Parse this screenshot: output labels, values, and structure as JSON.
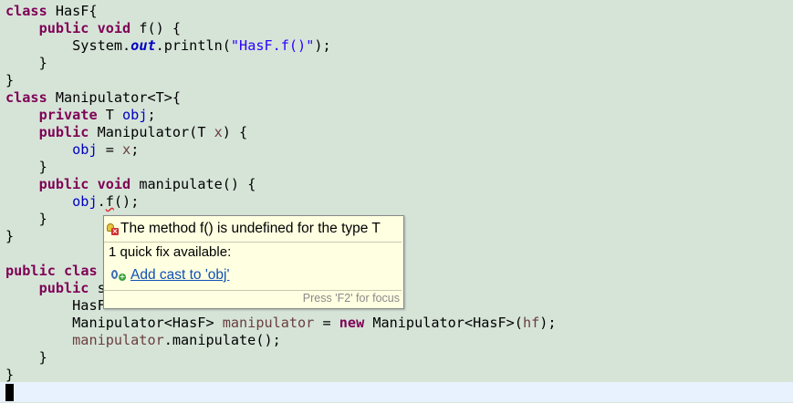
{
  "code": {
    "l1": {
      "kw1": "class",
      "rest": " HasF{"
    },
    "l2": {
      "indent": "    ",
      "kw1": "public",
      "sp": " ",
      "kw2": "void",
      "rest": " f() {"
    },
    "l3": {
      "indent": "        ",
      "pre": "System.",
      "static": "out",
      "mid": ".println(",
      "str": "\"HasF.f()\"",
      "post": ");"
    },
    "l4": {
      "text": "    }"
    },
    "l5": {
      "text": "}"
    },
    "l6": {
      "kw1": "class",
      "rest": " Manipulator<T>{"
    },
    "l7": {
      "indent": "    ",
      "kw1": "private",
      "mid": " T ",
      "fld": "obj",
      "post": ";"
    },
    "l8": {
      "indent": "    ",
      "kw1": "public",
      "mid": " Manipulator(T ",
      "loc": "x",
      "post": ") {"
    },
    "l9": {
      "indent": "        ",
      "fld": "obj",
      "mid": " = ",
      "loc": "x",
      "post": ";"
    },
    "l10": {
      "text": "    }"
    },
    "l11": {
      "indent": "    ",
      "kw1": "public",
      "sp": " ",
      "kw2": "void",
      "rest": " manipulate() {"
    },
    "l12": {
      "indent": "        ",
      "fld": "obj",
      "dot": ".",
      "err": "f",
      "post": "();"
    },
    "l13": {
      "text": "    }"
    },
    "l14": {
      "text": "}"
    },
    "l16": {
      "kw1": "public",
      "sp": " ",
      "kw2": "clas"
    },
    "l17": {
      "indent": "    ",
      "kw1": "public",
      "rest": " s"
    },
    "l18": {
      "indent": "        ",
      "rest": "HasF"
    },
    "l19": {
      "indent": "        ",
      "pre": "Manipulator<HasF> ",
      "loc": "manipulator",
      "mid": " = ",
      "kw": "new",
      "mid2": " Manipulator<HasF>(",
      "loc2": "hf",
      "post": ");"
    },
    "l20": {
      "indent": "        ",
      "loc": "manipulator",
      "post": ".manipulate();"
    },
    "l21": {
      "text": "    }"
    },
    "l22": {
      "text": "}"
    }
  },
  "hover": {
    "message": "The method f() is undefined for the type T",
    "fix_count": "1 quick fix available:",
    "fix_label": "Add cast to 'obj'",
    "footer": "Press 'F2' for focus"
  },
  "colors": {
    "background": "#d6e4d8",
    "keyword": "#7f0055",
    "field": "#0000c0",
    "string": "#2a00ff",
    "local_variable": "#6a3e3e",
    "hover_background": "#ffffe1",
    "link": "#0f4fb4",
    "current_line": "#e8f2fe"
  },
  "icons": {
    "error": "error-lightbulb-icon",
    "quick_fix": "quick-fix-cast-icon"
  }
}
